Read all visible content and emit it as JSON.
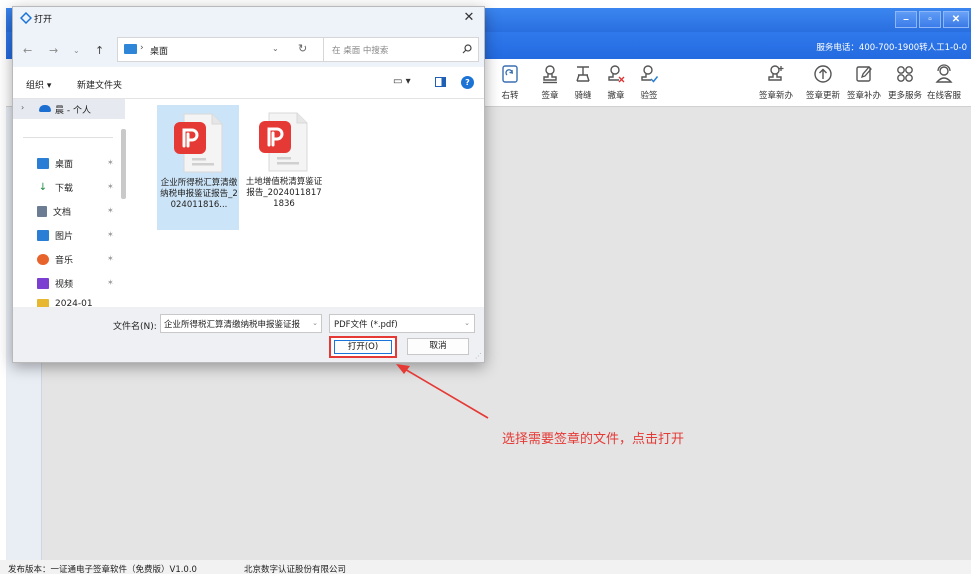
{
  "app": {
    "window_buttons": [
      "–",
      "▫",
      "✕"
    ],
    "service_text": "服务电话：400-700-1900转人工1-0-0",
    "toolbar_left": [
      {
        "label": "右转",
        "icon": "rotate-right-icon"
      },
      {
        "label": "签章",
        "icon": "stamp-icon"
      },
      {
        "label": "骑缝",
        "icon": "seam-stamp-icon"
      },
      {
        "label": "撤章",
        "icon": "revoke-stamp-icon"
      },
      {
        "label": "验签",
        "icon": "verify-signature-icon"
      }
    ],
    "toolbar_right": [
      {
        "label": "签章新办",
        "icon": "new-stamp-icon"
      },
      {
        "label": "签章更新",
        "icon": "update-stamp-icon"
      },
      {
        "label": "签章补办",
        "icon": "reissue-stamp-icon"
      },
      {
        "label": "更多服务",
        "icon": "more-services-icon"
      },
      {
        "label": "在线客服",
        "icon": "online-support-icon"
      }
    ],
    "status": {
      "version": "发布版本：一证通电子签章软件（免费版）V1.0.0",
      "company": "北京数字认证股份有限公司"
    }
  },
  "dialog": {
    "title": "打开",
    "address": {
      "sep": "›",
      "location": "桌面"
    },
    "search_placeholder": "在 桌面 中搜索",
    "commands": {
      "organize": "组织 ▾",
      "new_folder": "新建文件夹"
    },
    "sidebar": {
      "top": "晨 - 个人",
      "items": [
        {
          "label": "桌面",
          "color": "#2a7fd4"
        },
        {
          "label": "下载",
          "color": "#1f8a3f"
        },
        {
          "label": "文档",
          "color": "#6b7c93"
        },
        {
          "label": "图片",
          "color": "#2a7fd4"
        },
        {
          "label": "音乐",
          "color": "#e8632b"
        },
        {
          "label": "视频",
          "color": "#7b3fd1"
        },
        {
          "label": "2024-01",
          "color": "#e8b730"
        }
      ]
    },
    "files": [
      {
        "name": "企业所得税汇算清缴纳税申报鉴证报告_2024011816...",
        "selected": true
      },
      {
        "name": "土地增值税清算鉴证报告_20240118171836",
        "selected": false
      }
    ],
    "filename_label": "文件名(N):",
    "filename_value": "企业所得税汇算清缴纳税申报鉴证报",
    "filetype_value": "PDF文件 (*.pdf)",
    "open_label": "打开(O)",
    "cancel_label": "取消"
  },
  "annotation": {
    "text": "选择需要签章的文件，点击打开",
    "color": "#e53935"
  }
}
